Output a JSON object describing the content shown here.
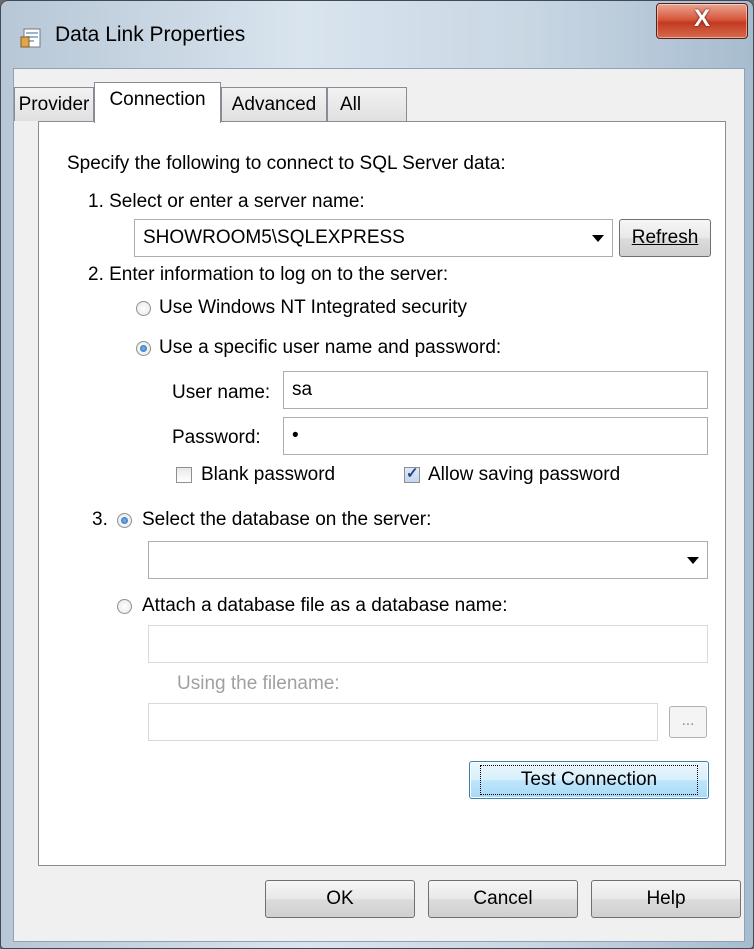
{
  "window": {
    "title": "Data Link Properties",
    "close_symbol": "X"
  },
  "tabs": [
    {
      "label": "Provider",
      "active": false
    },
    {
      "label": "Connection",
      "active": true
    },
    {
      "label": "Advanced",
      "active": false
    },
    {
      "label": "All",
      "active": false
    }
  ],
  "connection": {
    "intro": "Specify the following to connect to SQL Server data:",
    "step1_label": "1. Select or enter a server name:",
    "server_name": "SHOWROOM5\\SQLEXPRESS",
    "refresh_button": "Refresh",
    "step2_label": "2. Enter information to log on to the server:",
    "radio_windows_nt": "Use Windows NT Integrated security",
    "radio_specific_user": "Use a specific user name and password:",
    "username_label": "User name:",
    "username_value": "sa",
    "password_label": "Password:",
    "password_value": "•",
    "blank_password_label": "Blank password",
    "blank_password_checked": false,
    "allow_saving_label": "Allow saving password",
    "allow_saving_checked": true,
    "step3_number": "3.",
    "radio_select_db": "Select the database on the server:",
    "database_value": "",
    "radio_attach_db": "Attach a database file as a database name:",
    "attach_name_value": "",
    "filename_label": "Using the filename:",
    "filename_value": "",
    "browse_button": "...",
    "test_button": "Test Connection"
  },
  "footer": {
    "ok": "OK",
    "cancel": "Cancel",
    "help": "Help"
  }
}
